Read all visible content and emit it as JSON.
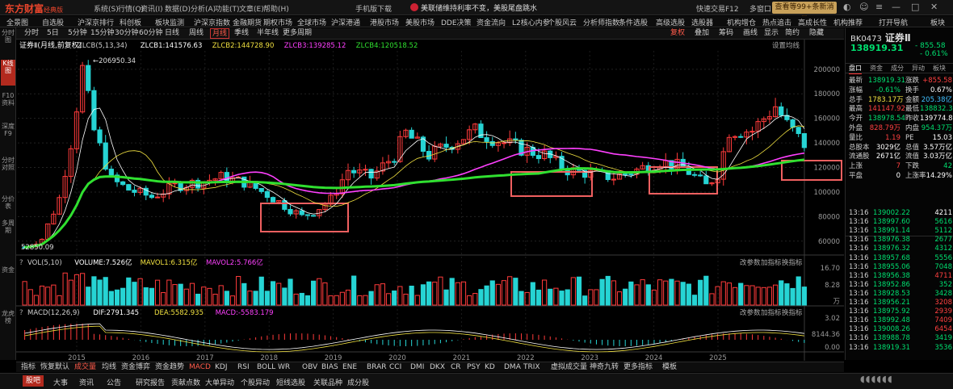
{
  "app": {
    "logo": "东方财富",
    "logo_sub": "经典版",
    "menu": [
      "系统(S)",
      "行情(Q)",
      "资讯(I)",
      "数据(D)",
      "分析(A)",
      "功能(T)",
      "文章(E)",
      "帮助(H)"
    ],
    "download": "手机版下载",
    "notice": "美联储维持利率不变，美股尾盘跳水",
    "quick_trade": "快速交易F12",
    "multi_window": "多窗口",
    "promo": "查看等99+条新消息"
  },
  "navbar": [
    "全景图",
    "自选股",
    "沪深京排行",
    "科创板",
    "板块监测",
    "沪深京指数",
    "金融期货",
    "期权市场",
    "全球市场",
    "沪深港通",
    "港股市场",
    "美股市场",
    "DDE决策",
    "资金流向",
    "L2核心内参",
    "个股风云",
    "分析师指数",
    "条件选股",
    "高级选股",
    "选股器",
    "机构增仓",
    "热点追击",
    "高成长性",
    "机构推荐",
    "打开导航",
    "板块"
  ],
  "leftbar": [
    "分时图",
    "K线图",
    "F10资料",
    "深度F9",
    "分时对照",
    "分价表",
    "多周期",
    "资金",
    "龙虎榜"
  ],
  "toolbar": [
    "分时",
    "5日",
    "5分钟",
    "15分钟",
    "30分钟",
    "60分钟",
    "日线",
    "周线",
    "月线",
    "季线",
    "半年线",
    "更多周期"
  ],
  "toolbar_right": [
    "复权",
    "叠加",
    "筹码",
    "画线",
    "显示",
    "简约",
    "隐藏"
  ],
  "main": {
    "caption": "证券Ⅱ",
    "caption_sub": "(月线,前复权)",
    "legend": [
      {
        "label": "ZLCB(5,13,34)",
        "color": "#cfcfcf"
      },
      {
        "label": "ZLCB1:141576.63",
        "color": "#ffffff"
      },
      {
        "label": "ZLCB2:144728.90",
        "color": "#f0e040"
      },
      {
        "label": "ZLCB3:139285.12",
        "color": "#ff40ff"
      },
      {
        "label": "ZLCB4:120518.52",
        "color": "#30e030"
      }
    ],
    "settings": "设置均线",
    "max_label": "206950.34",
    "min_label": "52850.09"
  },
  "vol": {
    "legend": [
      {
        "label": "VOL(5,10)",
        "color": "#cfcfcf"
      },
      {
        "label": "VOLUME:7.526亿",
        "color": "#ffffff"
      },
      {
        "label": "MAVOL1:6.315亿",
        "color": "#f0e040"
      },
      {
        "label": "MAVOL2:5.766亿",
        "color": "#ff40ff"
      }
    ],
    "actions": [
      "改参数",
      "加指标",
      "换指标"
    ],
    "ticks": [
      "16.70",
      "8.28",
      "万"
    ]
  },
  "macd": {
    "legend": [
      {
        "label": "MACD(12,26,9)",
        "color": "#cfcfcf"
      },
      {
        "label": "DIF:2791.345",
        "color": "#ffffff"
      },
      {
        "label": "DEA:5582.935",
        "color": "#f0e040"
      },
      {
        "label": "MACD:-5583.179",
        "color": "#ff40ff"
      }
    ],
    "actions": [
      "改参数",
      "加指标",
      "换指标"
    ],
    "ticks": [
      "3.02",
      "8144.36",
      "0.00"
    ]
  },
  "chart_data": {
    "type": "candlestick",
    "title": "证券Ⅱ",
    "period": "月线",
    "ylim": [
      50000,
      215000
    ],
    "y_ticks": [
      "200000",
      "180000",
      "160000",
      "140000",
      "120000",
      "100000",
      "80000",
      "60000"
    ],
    "x_ticks": [
      "2015",
      "2016",
      "2017",
      "2018",
      "2019",
      "2020",
      "2021",
      "2022",
      "2023",
      "2024",
      "2025"
    ],
    "annotations": {
      "max": "206950.34",
      "min": "52850.09"
    }
  },
  "right": {
    "code": "BK0473",
    "name": "证券Ⅱ",
    "price": "138919.31",
    "change": "- 855.58",
    "pct": "- 0.61%",
    "tabs": [
      "盘口",
      "资金",
      "成分",
      "异动",
      "板块"
    ],
    "quotes": [
      [
        "最新",
        "138919.31",
        "涨跌",
        "+855.58",
        "#00e070",
        "#ff4040"
      ],
      [
        "涨幅",
        "-0.61%",
        "换手",
        "0.67%",
        "#00e070",
        "#ffffff"
      ],
      [
        "总手",
        "1783.17万",
        "金额",
        "205.38亿",
        "#f0e040",
        "#40c0ff"
      ],
      [
        "最高",
        "141147.92",
        "最低",
        "138832.31",
        "#ff4040",
        "#00e070"
      ],
      [
        "今开",
        "138978.54",
        "昨收",
        "139774.89",
        "#00e070",
        "#ffffff"
      ],
      [
        "外盘",
        "828.79万",
        "内盘",
        "954.37万",
        "#ff4040",
        "#00e070"
      ],
      [
        "量比",
        "1.19",
        "PE",
        "15.03",
        "#ff4040",
        "#ffffff"
      ],
      [
        "总股本",
        "3029亿",
        "总值",
        "3.57万亿",
        "#ffffff",
        "#ffffff"
      ],
      [
        "流通股",
        "2671亿",
        "流值",
        "3.03万亿",
        "#ffffff",
        "#ffffff"
      ],
      [
        "上涨",
        "7",
        "下跌",
        "42",
        "#ff4040",
        "#00e070"
      ],
      [
        "平盘",
        "0",
        "上涨率",
        "14.29%",
        "#ffffff",
        "#ffffff"
      ]
    ],
    "ticks": [
      [
        "13:16",
        "139002.22",
        "4211",
        "#00e070",
        "#ffffff"
      ],
      [
        "13:16",
        "138997.60",
        "5616",
        "#00e070",
        "#00e070"
      ],
      [
        "13:16",
        "138991.14",
        "5112",
        "#00e070",
        "#00e070"
      ],
      [
        "13:16",
        "138976.38",
        "2677",
        "#00e070",
        "#00e070"
      ],
      [
        "13:16",
        "138976.32",
        "4312",
        "#00e070",
        "#00e070"
      ],
      [
        "13:16",
        "138957.68",
        "5556",
        "#00e070",
        "#00e070"
      ],
      [
        "13:16",
        "138955.06",
        "7048",
        "#00e070",
        "#00e070"
      ],
      [
        "13:16",
        "138956.38",
        "4711",
        "#00e070",
        "#ff4040"
      ],
      [
        "13:16",
        "138952.86",
        "352",
        "#00e070",
        "#00e070"
      ],
      [
        "13:16",
        "138928.53",
        "3428",
        "#00e070",
        "#00e070"
      ],
      [
        "13:16",
        "138956.21",
        "3208",
        "#00e070",
        "#ff4040"
      ],
      [
        "13:16",
        "138975.92",
        "2939",
        "#00e070",
        "#ff4040"
      ],
      [
        "13:16",
        "138992.48",
        "7409",
        "#00e070",
        "#ff4040"
      ],
      [
        "13:16",
        "139008.26",
        "6454",
        "#00e070",
        "#ff4040"
      ],
      [
        "13:16",
        "138988.78",
        "3419",
        "#00e070",
        "#00e070"
      ],
      [
        "13:16",
        "138919.31",
        "3536",
        "#00e070",
        "#00e070"
      ]
    ]
  },
  "bottombar": [
    "指标",
    "恢复默认",
    "成交量",
    "均线",
    "资金博弈",
    "资金趋势",
    "MACD",
    "KDJ",
    "RSI",
    "BOLL",
    "WR",
    "OBV",
    "BIAS",
    "ENE",
    "BRAR",
    "CCI",
    "DMI",
    "DKX",
    "CR",
    "PSY",
    "KD",
    "DMA",
    "TRIX",
    "虚拟成交量",
    "神奇九转",
    "更多指标",
    "模板"
  ],
  "statusbar": [
    "股吧",
    "大事",
    "资讯",
    "公告",
    "研究报告",
    "贡献点数",
    "大单异动",
    "个股异动",
    "短线选股",
    "关联品种",
    "成分股"
  ]
}
